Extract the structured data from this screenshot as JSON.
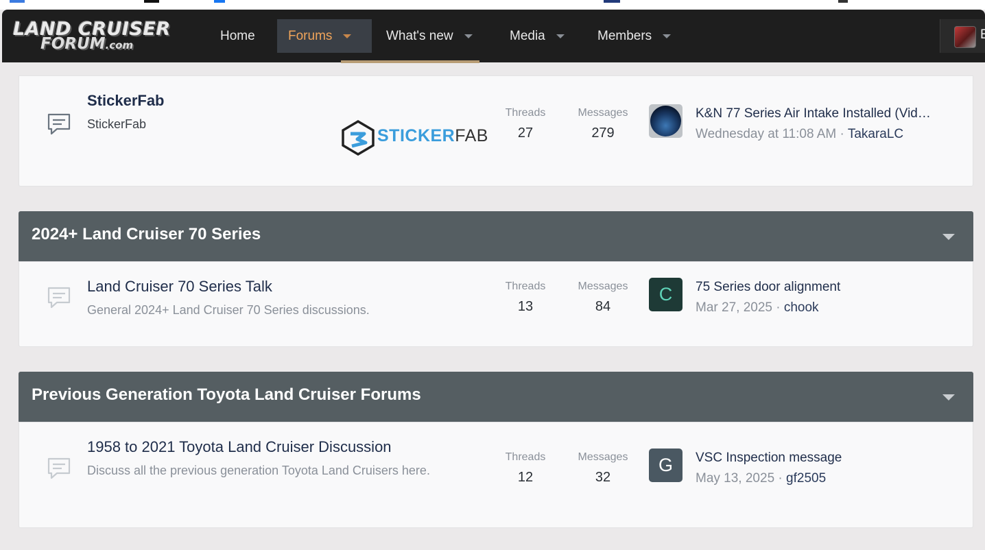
{
  "nav": {
    "logo_line1": "LAND CRUISER",
    "logo_line2": "FORUM",
    "logo_suffix": ".com",
    "items": [
      {
        "label": "Home"
      },
      {
        "label": "Forums"
      },
      {
        "label": "What's new"
      },
      {
        "label": "Media"
      },
      {
        "label": "Members"
      }
    ],
    "user_initial": "E",
    "active_color": "#f0a45a"
  },
  "sections": [
    {
      "nodes": [
        {
          "title": "StickerFab",
          "description": "StickerFab",
          "sponsor_logo": {
            "part1": "STICKER",
            "part2": "FAB"
          },
          "threads_label": "Threads",
          "threads": "27",
          "messages_label": "Messages",
          "messages": "279",
          "last_title": "K&N 77 Series Air Intake Installed (Vid…",
          "last_time": "Wednesday at 11:08 AM",
          "last_sep": " · ",
          "last_user": "TakaraLC"
        }
      ]
    },
    {
      "title": "2024+ Land Cruiser 70 Series",
      "nodes": [
        {
          "title": "Land Cruiser 70 Series Talk",
          "description": "General 2024+ Land Cruiser 70 Series discussions.",
          "threads_label": "Threads",
          "threads": "13",
          "messages_label": "Messages",
          "messages": "84",
          "avatar_letter": "C",
          "avatar_color": "#1e3a36",
          "avatar_text_color": "#5fd3b8",
          "last_title": "75 Series door alignment",
          "last_time": "Mar 27, 2025",
          "last_sep": " · ",
          "last_user": "chook"
        }
      ]
    },
    {
      "title": "Previous Generation Toyota Land Cruiser Forums",
      "nodes": [
        {
          "title": "1958 to 2021 Toyota Land Cruiser Discussion",
          "description": "Discuss all the previous generation Toyota Land Cruisers here.",
          "threads_label": "Threads",
          "threads": "12",
          "messages_label": "Messages",
          "messages": "32",
          "avatar_letter": "G",
          "avatar_color": "#4a5862",
          "avatar_text_color": "#ffffff",
          "last_title": "VSC Inspection message",
          "last_time": "May 13, 2025",
          "last_sep": " · ",
          "last_user": "gf2505"
        }
      ]
    }
  ]
}
